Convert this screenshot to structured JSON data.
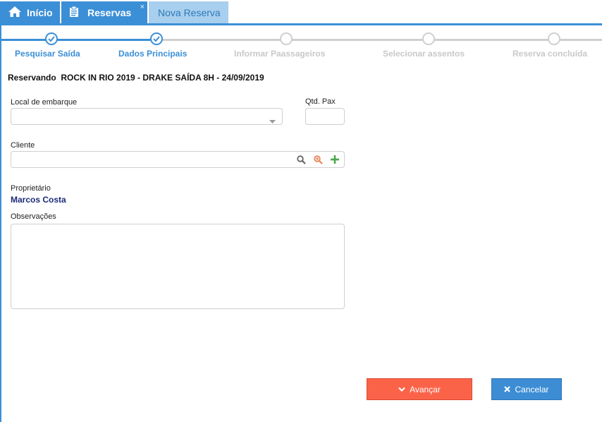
{
  "tabs": [
    {
      "label": "Início",
      "icon": "home-icon"
    },
    {
      "label": "Reservas",
      "icon": "clipboard-icon",
      "close": "×"
    },
    {
      "label": "Nova Reserva"
    }
  ],
  "steps": [
    {
      "label": "Pesquisar Saída",
      "status": "done"
    },
    {
      "label": "Dados Principais",
      "status": "done"
    },
    {
      "label": "Informar Paassageiros",
      "status": "todo"
    },
    {
      "label": "Selecionar assentos",
      "status": "todo"
    },
    {
      "label": "Reserva concluída",
      "status": "todo"
    }
  ],
  "reserving": "Reservando  ROCK IN RIO 2019 - DRAKE SAÍDA 8H - 24/09/2019",
  "form": {
    "boarding_label": "Local de embarque",
    "boarding_value": "",
    "pax_label": "Qtd. Pax",
    "pax_value": "",
    "client_label": "Cliente",
    "client_value": "",
    "owner_label": "Proprietário",
    "owner_value": "Marcos Costa",
    "notes_label": "Observações",
    "notes_value": ""
  },
  "buttons": {
    "advance": "Avançar",
    "cancel": "Cancelar"
  },
  "colors": {
    "primary": "#3b8fd6",
    "active_tab": "#a8cfee",
    "advance": "#fb6349",
    "inactive_step": "#cfcfcf",
    "owner_text": "#1b2b7a"
  }
}
